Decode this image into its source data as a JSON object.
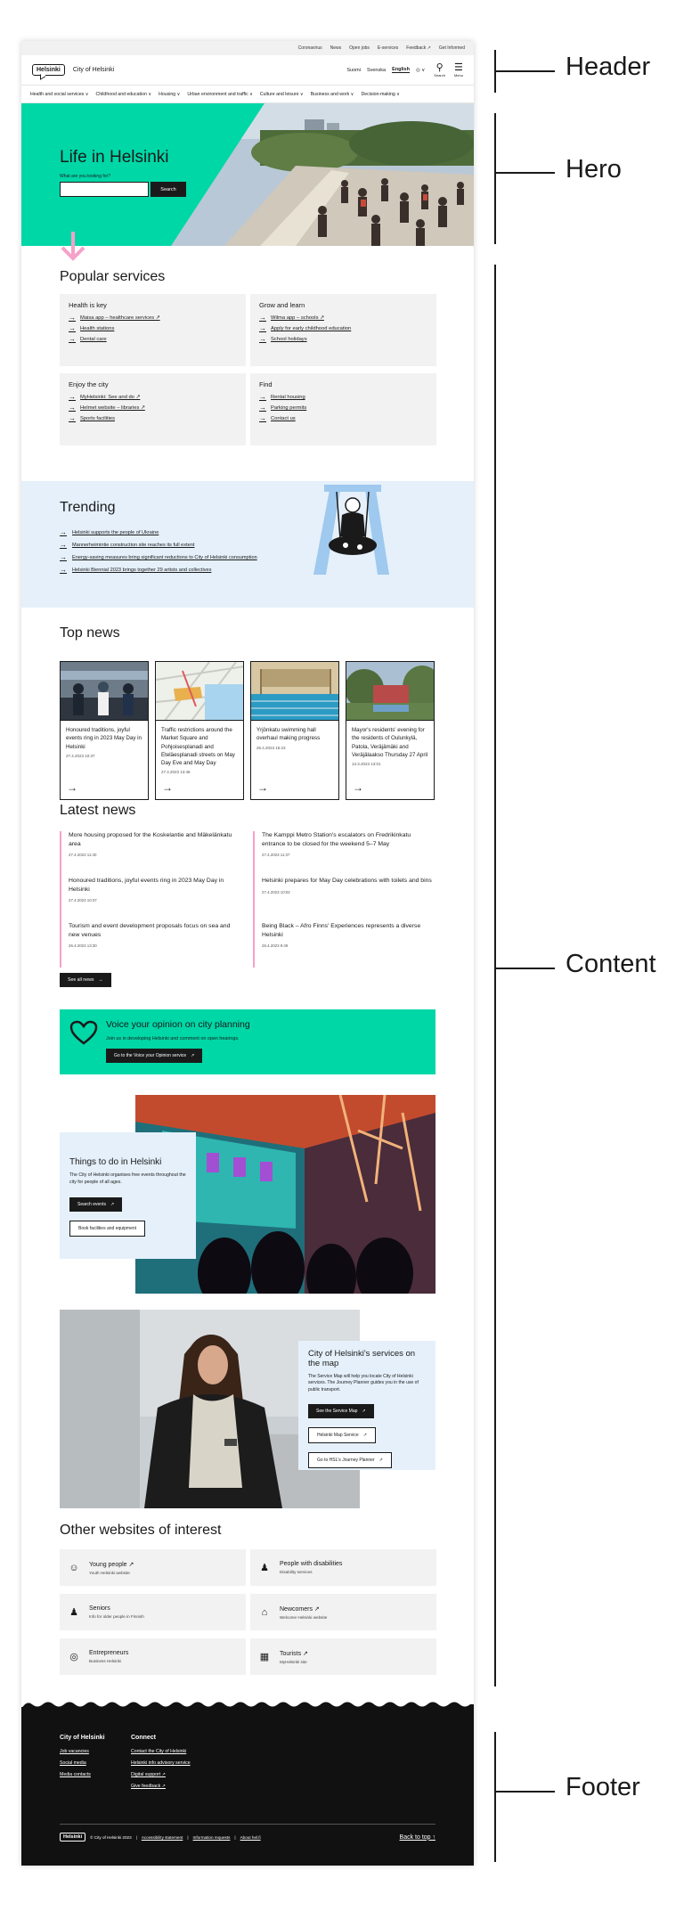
{
  "annotations": {
    "header": "Header",
    "hero": "Hero",
    "content": "Content",
    "footer": "Footer"
  },
  "topbar": {
    "links": [
      "Coronavirus",
      "News",
      "Open jobs",
      "E-services",
      "Feedback ↗",
      "Get Informed"
    ]
  },
  "header": {
    "logo": "Helsinki",
    "site_name": "City of Helsinki",
    "languages": [
      "Suomi",
      "Svenska",
      "English"
    ],
    "active_language": "English",
    "lang_more": "◎ ∨",
    "search_label": "Search",
    "menu_label": "Menu"
  },
  "nav": {
    "items": [
      "Health and social services ∨",
      "Childhood and education ∨",
      "Housing ∨",
      "Urban environment and traffic ∨",
      "Culture and leisure ∨",
      "Business and work ∨",
      "Decision-making ∨"
    ]
  },
  "hero": {
    "title": "Life in Helsinki",
    "search_question": "What are you looking for?",
    "search_value": "",
    "search_button": "Search"
  },
  "popular": {
    "title": "Popular services",
    "cards": [
      {
        "title": "Health is key",
        "links": [
          "Maisa app – healthcare services ↗",
          "Health stations",
          "Dental care"
        ]
      },
      {
        "title": "Grow and learn",
        "links": [
          "Wilma app – schools ↗",
          "Apply for early childhood education",
          "School holidays"
        ]
      },
      {
        "title": "Enjoy the city",
        "links": [
          "MyHelsinki: See and do ↗",
          "Helmet website – libraries ↗",
          "Sports facilities"
        ]
      },
      {
        "title": "Find",
        "links": [
          "Rental housing",
          "Parking permits",
          "Contact us"
        ]
      }
    ]
  },
  "trending": {
    "title": "Trending",
    "links": [
      "Helsinki supports the people of Ukraine",
      "Mannerheimintie construction site reaches its full extent",
      "Energy-saving measures bring significant reductions to City of Helsinki consumption",
      "Helsinki Biennial 2023 brings together 29 artists and collectives"
    ]
  },
  "top_news": {
    "title": "Top news",
    "items": [
      {
        "title": "Honoured traditions, joyful events ring in 2023 May Day in Helsinki",
        "date": "27.4.2023 10:37"
      },
      {
        "title": "Traffic restrictions around the Market Square and Pohjoisesplanadi and Eteläesplanadi streets on May Day Eve and May Day",
        "date": "27.4.2023 13:46"
      },
      {
        "title": "Yrjönkatu swimming hall overhaul making progress",
        "date": "26.4.2023 15:23"
      },
      {
        "title": "Mayor's residents' evening for the residents of Oulunkylä, Patola, Veräjämäki and Veräjälaakso Thursday 27 April",
        "date": "13.3.2023 13:01"
      }
    ]
  },
  "latest_news": {
    "title": "Latest news",
    "items": [
      {
        "title": "More housing proposed for the Koskelantie and Mäkelänkatu area",
        "date": "27.4.2023 11:40"
      },
      {
        "title": "The Kamppi Metro Station's escalators on Fredrikinkatu entrance to be closed for the weekend 5–7 May",
        "date": "27.4.2023 11:37"
      },
      {
        "title": "Honoured traditions, joyful events ring in 2023 May Day in Helsinki",
        "date": "27.4.2023 10:37"
      },
      {
        "title": "Helsinki prepares for May Day celebrations with toilets and bins",
        "date": "27.4.2023 10:02"
      },
      {
        "title": "Tourism and event development proposals focus on sea and new venues",
        "date": "26.4.2023 13:30"
      },
      {
        "title": "Being Black – Afro Finns' Experiences represents a diverse Helsinki",
        "date": "26.4.2023 9:49"
      }
    ],
    "all_button": "See all news"
  },
  "voice": {
    "title": "Voice your opinion on city planning",
    "text": "Join us in developing Helsinki and comment on open hearings.",
    "button": "Go to the Voice your Opinion service"
  },
  "things": {
    "title": "Things to do in Helsinki",
    "text": "The City of Helsinki organises free events throughout the city for people of all ages.",
    "button1": "Search events",
    "button2": "Book facilities and equipment"
  },
  "service_map": {
    "title": "City of Helsinki's services on the map",
    "text": "The Service Map will help you locate City of Helsinki services. The Journey Planner guides you in the use of public transport.",
    "button1": "See the Service Map",
    "button2": "Helsinki Map Service",
    "button3": "Go to HSL's Journey Planner"
  },
  "other_sites": {
    "title": "Other websites of interest",
    "items": [
      {
        "title": "Young people ↗",
        "sub": "Youth Helsinki website",
        "icon": "group-icon"
      },
      {
        "title": "People with disabilities",
        "sub": "Disability services",
        "icon": "person-icon"
      },
      {
        "title": "Seniors",
        "sub": "Info for older people in Finnish",
        "icon": "senior-icon"
      },
      {
        "title": "Newcomers ↗",
        "sub": "Welcome Helsinki website",
        "icon": "home-icon"
      },
      {
        "title": "Entrepreneurs",
        "sub": "Business Helsinki",
        "icon": "target-icon"
      },
      {
        "title": "Tourists ↗",
        "sub": "MyHelsinki site",
        "icon": "map-icon"
      }
    ]
  },
  "footer": {
    "col1_title": "City of Helsinki",
    "col1_links": [
      "Job vacancies",
      "Social media",
      "Media contacts"
    ],
    "col2_title": "Connect",
    "col2_links": [
      "Contact the City of Helsinki",
      "Helsinki info advisory service",
      "Digital support ↗",
      "Give feedback ↗"
    ],
    "logo": "Helsinki",
    "copyright": "© City of Helsinki 2023",
    "bottom_links": [
      "Accessibility statement",
      "Information requests",
      "About hel.fi"
    ],
    "back_to_top": "Back to top ↑"
  }
}
